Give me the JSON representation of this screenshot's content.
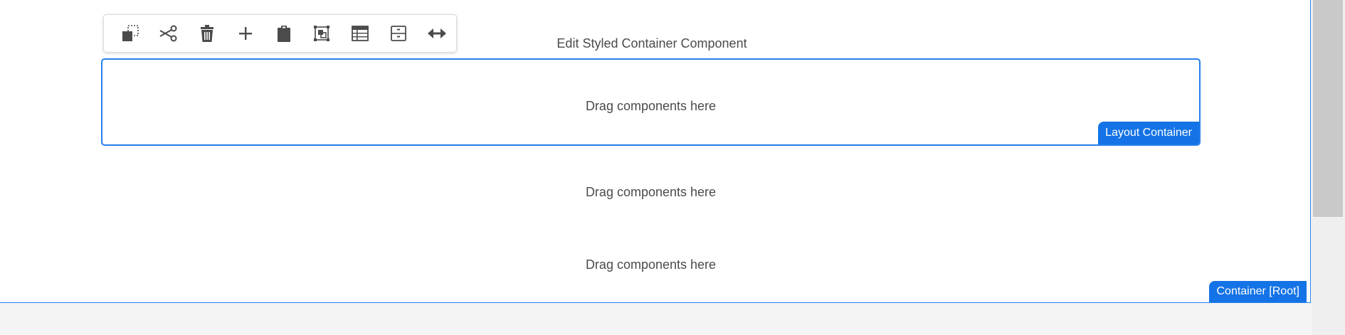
{
  "styled_container": {
    "title": "Edit Styled Container Component"
  },
  "layout_container": {
    "placeholder": "Drag components here",
    "badge_label": "Layout Container"
  },
  "drop_zones": [
    {
      "placeholder": "Drag components here"
    },
    {
      "placeholder": "Drag components here"
    }
  ],
  "root_container": {
    "badge_label": "Container [Root]"
  },
  "toolbar": {
    "actions": [
      {
        "name": "copy",
        "icon": "copy-icon"
      },
      {
        "name": "cut",
        "icon": "scissors-icon"
      },
      {
        "name": "delete",
        "icon": "trash-icon"
      },
      {
        "name": "insert",
        "icon": "plus-icon"
      },
      {
        "name": "paste",
        "icon": "clipboard-icon"
      },
      {
        "name": "group",
        "icon": "group-icon"
      },
      {
        "name": "properties",
        "icon": "table-icon"
      },
      {
        "name": "policy",
        "icon": "drawer-icon"
      },
      {
        "name": "layout",
        "icon": "horizontal-resize-icon"
      }
    ]
  },
  "colors": {
    "accent": "#2680eb",
    "badge": "#1473e6",
    "text": "#4b4b4b"
  }
}
